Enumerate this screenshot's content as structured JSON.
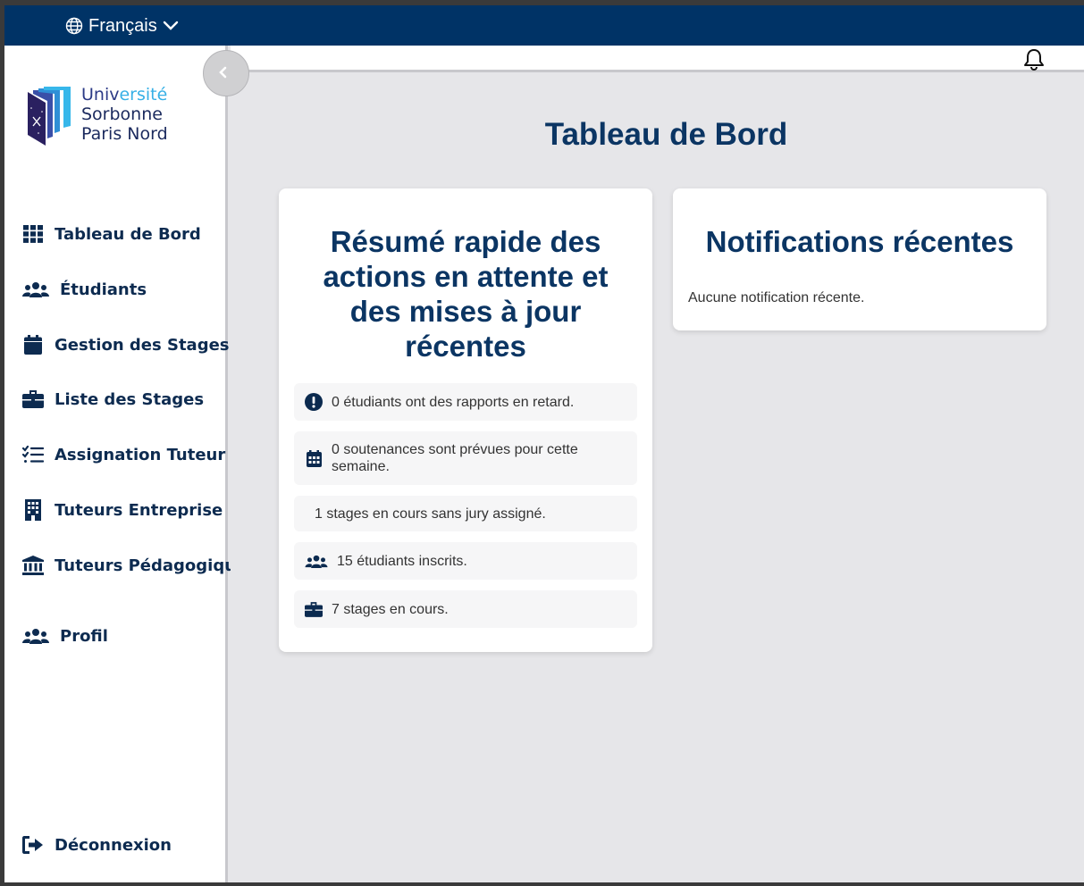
{
  "topbar": {
    "language_label": "Français",
    "globe_icon": "globe-icon",
    "chevron_icon": "chevron-down-icon",
    "bg_color": "#003366"
  },
  "sidebar": {
    "collapse_icon": "chevron-left-icon",
    "logo": {
      "line1_a": "Univ",
      "line1_b": "ersité",
      "line2": "Sorbonne",
      "line3": "Paris Nord"
    },
    "items": [
      {
        "label": "Tableau de Bord",
        "icon": "grid-icon"
      },
      {
        "label": "Étudiants",
        "icon": "users-icon"
      },
      {
        "label": "Gestion des Stages",
        "icon": "calendar-icon"
      },
      {
        "label": "Liste des Stages",
        "icon": "briefcase-icon"
      },
      {
        "label": "Assignation Tuteur",
        "icon": "checklist-icon"
      },
      {
        "label": "Tuteurs Entreprise",
        "icon": "building-icon"
      },
      {
        "label": "Tuteurs Pédagogiques",
        "icon": "university-icon"
      },
      {
        "label": "Profil",
        "icon": "users-icon"
      }
    ],
    "logout_label": "Déconnexion",
    "logout_icon": "sign-out-icon"
  },
  "header": {
    "bell_icon": "bell-icon"
  },
  "main": {
    "title": "Tableau de Bord",
    "summary_card": {
      "title": "Résumé rapide des actions en attente et des mises à jour récentes",
      "items": [
        {
          "text": "0 étudiants ont des rapports en retard.",
          "icon": "exclamation-circle-icon"
        },
        {
          "text": "0 soutenances sont prévues pour cette semaine.",
          "icon": "calendar-icon"
        },
        {
          "text": "1 stages en cours sans jury assigné.",
          "icon": ""
        },
        {
          "text": "15 étudiants inscrits.",
          "icon": "users-icon"
        },
        {
          "text": "7 stages en cours.",
          "icon": "briefcase-icon"
        }
      ]
    },
    "notifications_card": {
      "title": "Notifications récentes",
      "empty_text": "Aucune notification récente."
    }
  },
  "colors": {
    "primary_navy": "#0b3563",
    "sidebar_text": "#0d2b50",
    "background": "#e6e6e9"
  }
}
